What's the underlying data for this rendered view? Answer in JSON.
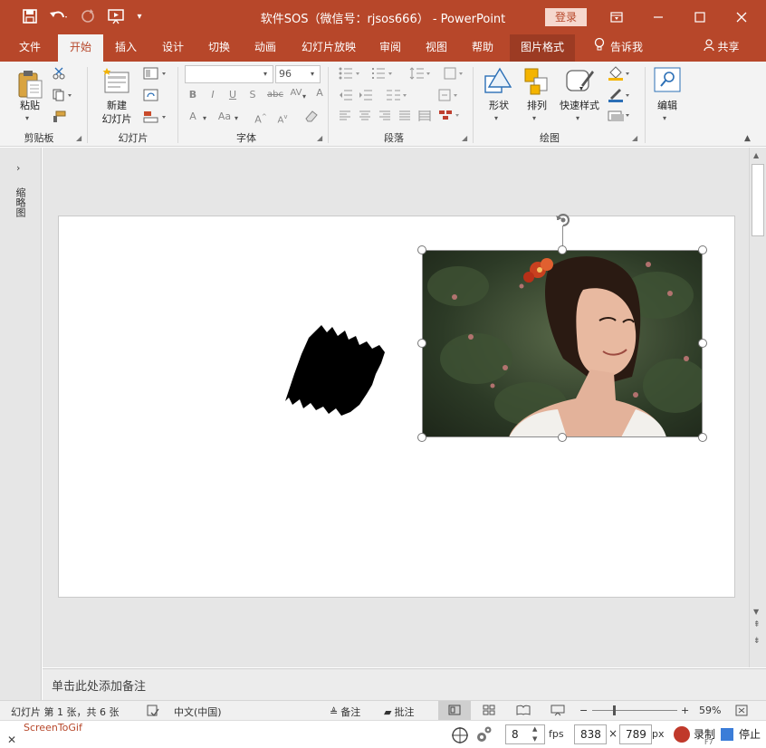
{
  "titlebar": {
    "title": "软件SOS（微信号：rjsos666） - PowerPoint",
    "login_label": "登录",
    "icons": [
      "save-icon",
      "undo-icon",
      "redo-icon",
      "slideshow-icon",
      "customize-icon",
      "ribbon-display-icon",
      "minimize-icon",
      "maximize-icon",
      "close-icon"
    ]
  },
  "tabs": [
    {
      "label": "文件"
    },
    {
      "label": "开始"
    },
    {
      "label": "插入"
    },
    {
      "label": "设计"
    },
    {
      "label": "切换"
    },
    {
      "label": "动画"
    },
    {
      "label": "幻灯片放映"
    },
    {
      "label": "审阅"
    },
    {
      "label": "视图"
    },
    {
      "label": "帮助"
    },
    {
      "label": "图片格式"
    }
  ],
  "tell_me": "告诉我",
  "share": "共享",
  "ribbon": {
    "clipboard": {
      "paste": "粘贴",
      "group": "剪贴板"
    },
    "slides": {
      "new_slide_line1": "新建",
      "new_slide_line2": "幻灯片",
      "group": "幻灯片"
    },
    "font": {
      "font_name": "",
      "font_size": "96",
      "group": "字体"
    },
    "paragraph": {
      "group": "段落"
    },
    "drawing": {
      "shape": "形状",
      "arrange": "排列",
      "quick_styles": "快速样式",
      "group": "绘图"
    },
    "editing": {
      "label": "编辑"
    }
  },
  "thumbpane": {
    "label": "缩略图"
  },
  "notes": {
    "placeholder": "单击此处添加备注"
  },
  "statusbar": {
    "slide_info": "幻灯片 第 1 张，共 6 张",
    "language": "中文(中国)",
    "notes": "备注",
    "comments": "批注",
    "zoom": "59%"
  },
  "screentogif": {
    "app_name": "ScreenToGif",
    "fps_value": "8",
    "fps_unit": "fps",
    "width": "838",
    "times": "×",
    "height": "789",
    "px_unit": "px",
    "record": "录制",
    "record_hint": "F7",
    "stop": "停止"
  },
  "colors": {
    "accent": "#b7472a",
    "ribbon_bg": "#f3f3f3",
    "workspace_bg": "#e6e6e6",
    "selection_handle": "#7a7a7a"
  }
}
